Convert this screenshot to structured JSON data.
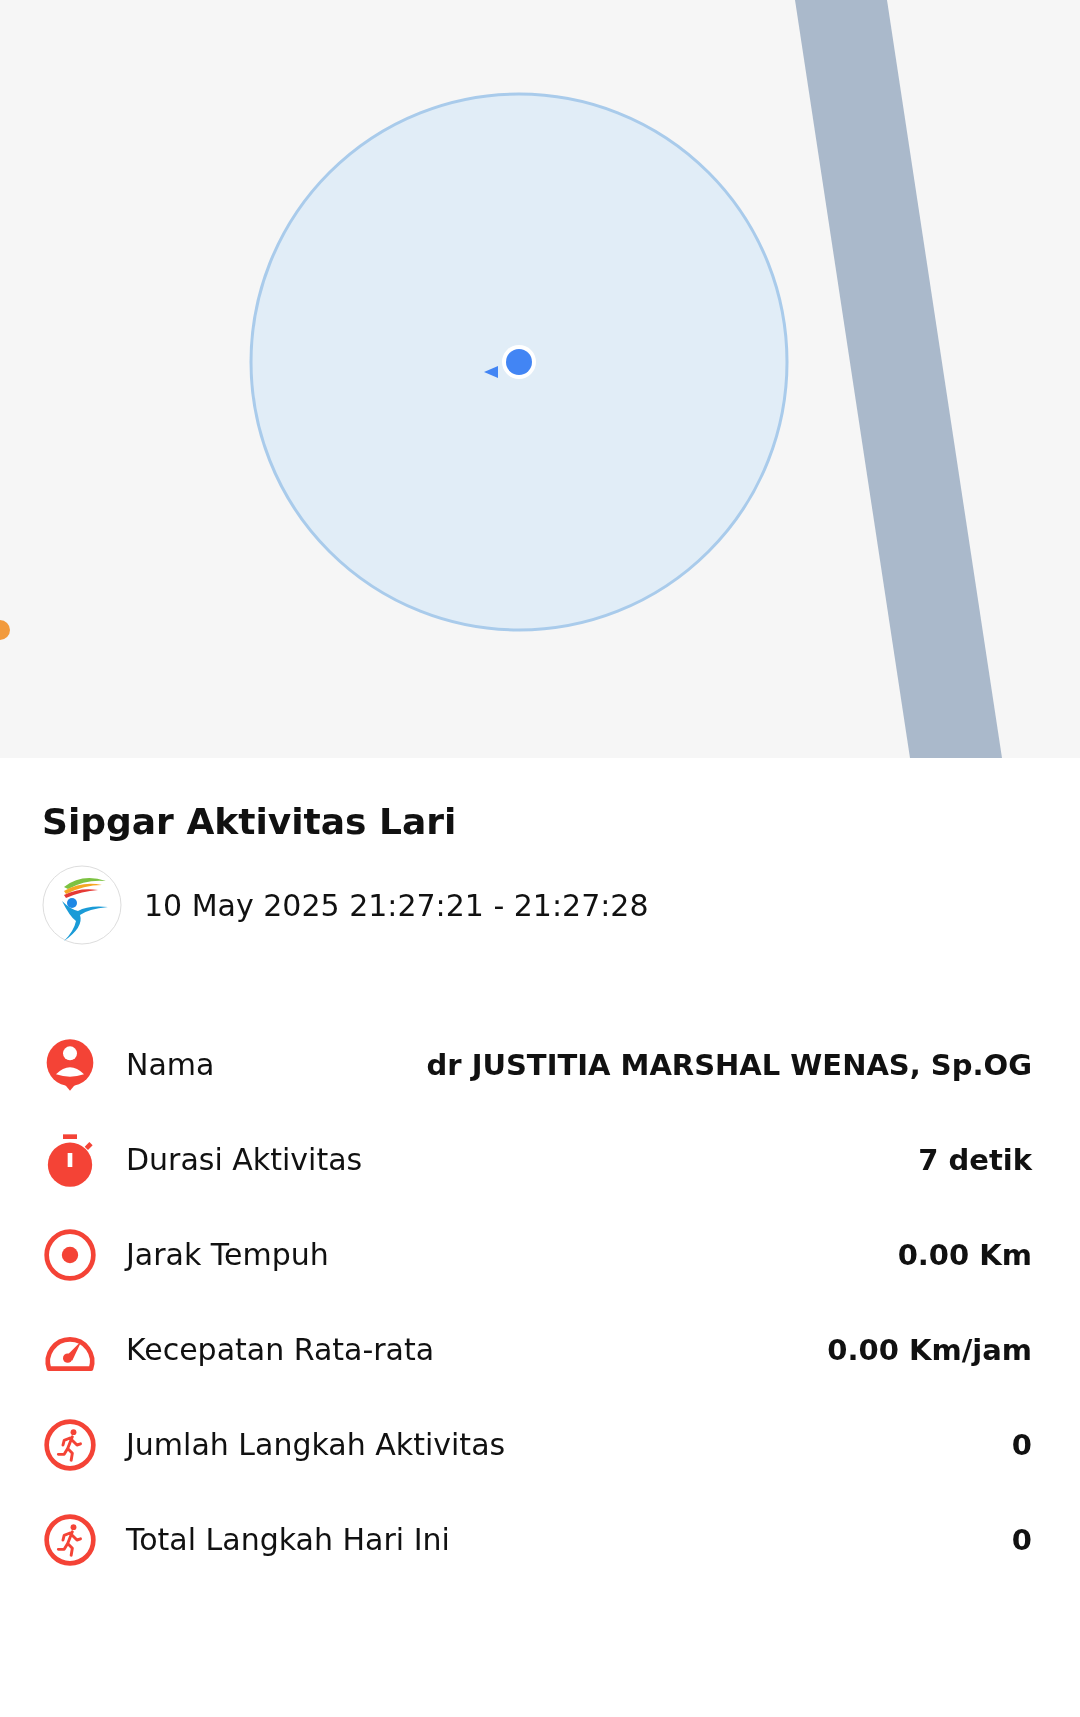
{
  "activity": {
    "title": "Sipgar Aktivitas Lari",
    "time_range": "10 May 2025 21:27:21 - 21:27:28"
  },
  "stats": [
    {
      "kind": "person",
      "label": "Nama",
      "value": "dr JUSTITIA MARSHAL WENAS, Sp.OG"
    },
    {
      "kind": "stopwatch",
      "label": "Durasi Aktivitas",
      "value": "7 detik"
    },
    {
      "kind": "target",
      "label": "Jarak Tempuh",
      "value": "0.00 Km"
    },
    {
      "kind": "speedometer",
      "label": "Kecepatan Rata-rata",
      "value": "0.00 Km/jam"
    },
    {
      "kind": "runner",
      "label": "Jumlah Langkah Aktivitas",
      "value": "0"
    },
    {
      "kind": "runner",
      "label": "Total Langkah Hari Ini",
      "value": "0"
    }
  ]
}
